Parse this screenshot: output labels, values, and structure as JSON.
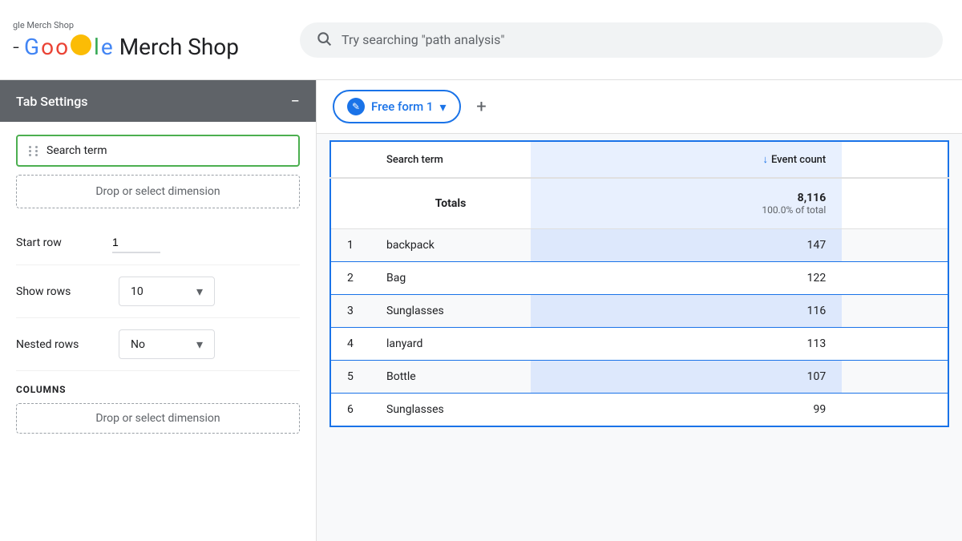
{
  "topbar": {
    "logo_small": "gle Merch Shop",
    "logo_full": "- Google Merch Shop",
    "search_placeholder": "Try searching \"path analysis\""
  },
  "sidebar": {
    "title": "Tab Settings",
    "minus_label": "−",
    "rows_dimension": "Search term",
    "drop_dimension_placeholder": "Drop or select dimension",
    "start_row_label": "Start row",
    "start_row_value": "1",
    "show_rows_label": "Show rows",
    "show_rows_value": "10",
    "nested_rows_label": "Nested rows",
    "nested_rows_value": "No",
    "columns_label": "COLUMNS",
    "drop_col_placeholder": "Drop or select dimension"
  },
  "tab": {
    "name": "Free form 1",
    "edit_icon": "✎",
    "add_icon": "+"
  },
  "table": {
    "col_dimension": "Search term",
    "col_metric": "Event count",
    "sort_arrow": "↓",
    "totals_label": "Totals",
    "totals_value": "8,116",
    "totals_pct": "100.0% of total",
    "rows": [
      {
        "num": "1",
        "term": "backpack",
        "count": "147"
      },
      {
        "num": "2",
        "term": "Bag",
        "count": "122"
      },
      {
        "num": "3",
        "term": "Sunglasses",
        "count": "116"
      },
      {
        "num": "4",
        "term": "lanyard",
        "count": "113"
      },
      {
        "num": "5",
        "term": "Bottle",
        "count": "107"
      },
      {
        "num": "6",
        "term": "Sunglasses",
        "count": "99"
      }
    ]
  }
}
